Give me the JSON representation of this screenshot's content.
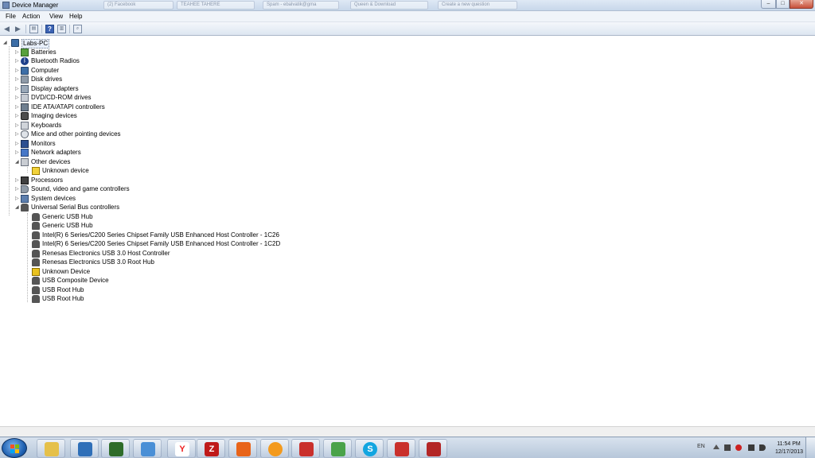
{
  "window": {
    "title": "Device Manager",
    "background_tabs": [
      "(2) Facebook",
      "TEAHEE TAHERE",
      "Spam - ebalvatik@gma",
      "Queen & Download",
      "Create a new question"
    ]
  },
  "menu": [
    "File",
    "Action",
    "View",
    "Help"
  ],
  "tree": {
    "root": "Labs-PC",
    "categories": [
      {
        "label": "Batteries",
        "icon": "battery-icon",
        "expanded": false
      },
      {
        "label": "Bluetooth Radios",
        "icon": "bluetooth-icon",
        "expanded": false
      },
      {
        "label": "Computer",
        "icon": "computer-icon",
        "expanded": false
      },
      {
        "label": "Disk drives",
        "icon": "disk-drive-icon",
        "expanded": false
      },
      {
        "label": "Display adapters",
        "icon": "display-adapter-icon",
        "expanded": false
      },
      {
        "label": "DVD/CD-ROM drives",
        "icon": "dvd-drive-icon",
        "expanded": false
      },
      {
        "label": "IDE ATA/ATAPI controllers",
        "icon": "ide-controller-icon",
        "expanded": false
      },
      {
        "label": "Imaging devices",
        "icon": "camera-icon",
        "expanded": false
      },
      {
        "label": "Keyboards",
        "icon": "keyboard-icon",
        "expanded": false
      },
      {
        "label": "Mice and other pointing devices",
        "icon": "mouse-icon",
        "expanded": false
      },
      {
        "label": "Monitors",
        "icon": "monitor-icon",
        "expanded": false
      },
      {
        "label": "Network adapters",
        "icon": "network-adapter-icon",
        "expanded": false
      },
      {
        "label": "Other devices",
        "icon": "other-devices-icon",
        "expanded": true,
        "children": [
          "Unknown device"
        ]
      },
      {
        "label": "Processors",
        "icon": "processor-icon",
        "expanded": false
      },
      {
        "label": "Sound, video and game controllers",
        "icon": "speaker-icon",
        "expanded": false
      },
      {
        "label": "System devices",
        "icon": "system-device-icon",
        "expanded": false
      },
      {
        "label": "Universal Serial Bus controllers",
        "icon": "usb-icon",
        "expanded": true,
        "children": [
          "Generic USB Hub",
          "Generic USB Hub",
          "Intel(R) 6 Series/C200 Series Chipset Family USB Enhanced Host Controller - 1C26",
          "Intel(R) 6 Series/C200 Series Chipset Family USB Enhanced Host Controller - 1C2D",
          "Renesas Electronics USB 3.0 Host Controller",
          "Renesas Electronics USB 3.0 Root Hub",
          "Unknown Device",
          "USB Composite Device",
          "USB Root Hub",
          "USB Root Hub"
        ]
      }
    ]
  },
  "taskbar": {
    "apps": [
      "explorer",
      "virtualbox",
      "media-center",
      "network",
      "yandex-browser",
      "filezilla",
      "office",
      "firefox",
      "toolbox",
      "image-viewer",
      "skype",
      "toolbox-2",
      "presentation"
    ],
    "tray_language": "EN",
    "clock_time": "11:54 PM",
    "clock_date": "12/17/2013"
  }
}
